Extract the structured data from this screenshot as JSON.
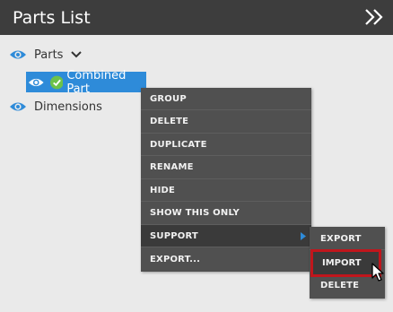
{
  "header": {
    "title": "Parts List",
    "collapse_icon": "double-chevron-right-icon"
  },
  "tree": {
    "parts_label": "Parts",
    "selected_label": "Combined Part",
    "dimensions_label": "Dimensions"
  },
  "context_menu": {
    "items": [
      "GROUP",
      "DELETE",
      "DUPLICATE",
      "RENAME",
      "HIDE",
      "SHOW THIS ONLY",
      "SUPPORT",
      "EXPORT..."
    ]
  },
  "submenu": {
    "items": [
      "EXPORT",
      "IMPORT",
      "DELETE"
    ]
  },
  "colors": {
    "header_bg": "#3d3d3d",
    "panel_bg": "#eaeaea",
    "selection_blue": "#2e8bd9",
    "eye_blue": "#2e8bd9",
    "menu_bg": "#505050",
    "highlight_red": "#c0161c",
    "check_green": "#6cc24a"
  }
}
